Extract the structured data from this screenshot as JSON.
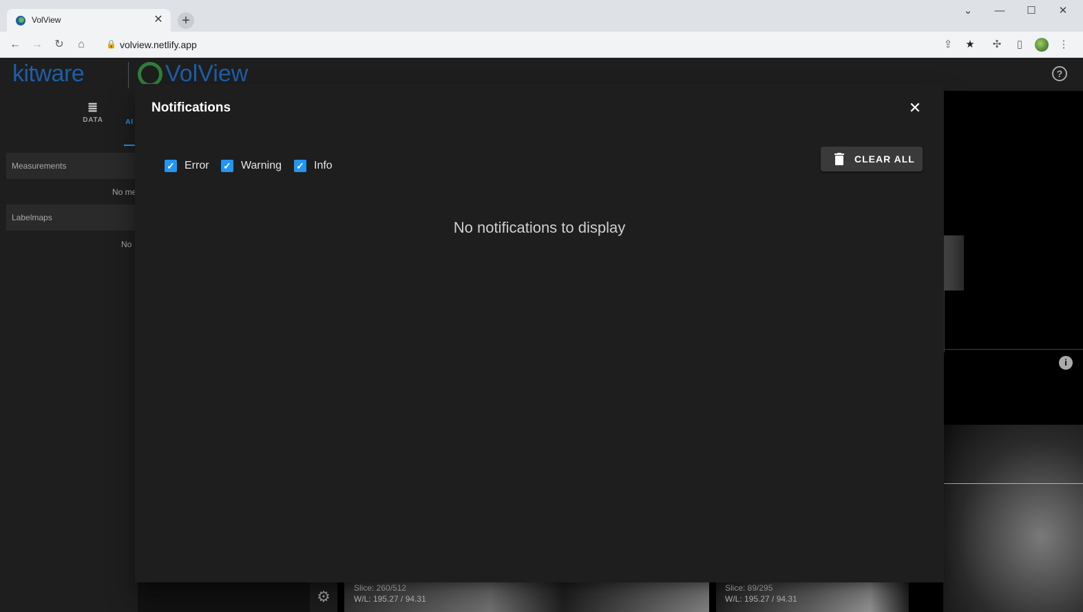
{
  "browser": {
    "tab_title": "VolView",
    "tab_close": "✕",
    "new_tab": "+",
    "url": "volview.netlify.app",
    "window_controls": [
      "⌄",
      "—",
      "☐",
      "✕"
    ]
  },
  "app": {
    "logo_left": "kitware",
    "logo_right": "VolView",
    "help": "?",
    "sidebar": {
      "tabs": [
        "DATA",
        "AI"
      ],
      "panels": [
        {
          "label": "Measurements",
          "empty": "No me"
        },
        {
          "label": "Labelmaps",
          "empty": "No"
        }
      ]
    },
    "viewports": [
      {
        "slice": "Slice: 260/512",
        "wl": "W/L: 195.27 / 94.31"
      },
      {
        "slice": "Slice: 89/295",
        "wl": "W/L: 195.27 / 94.31"
      }
    ]
  },
  "dialog": {
    "title": "Notifications",
    "close": "✕",
    "filters": [
      {
        "label": "Error",
        "checked": true
      },
      {
        "label": "Warning",
        "checked": true
      },
      {
        "label": "Info",
        "checked": true
      }
    ],
    "clear_all": "CLEAR ALL",
    "empty_message": "No notifications to display"
  },
  "colors": {
    "accent": "#2196f3",
    "dialog_bg": "#1e1e1e",
    "brand_blue": "#1d5ea8"
  }
}
